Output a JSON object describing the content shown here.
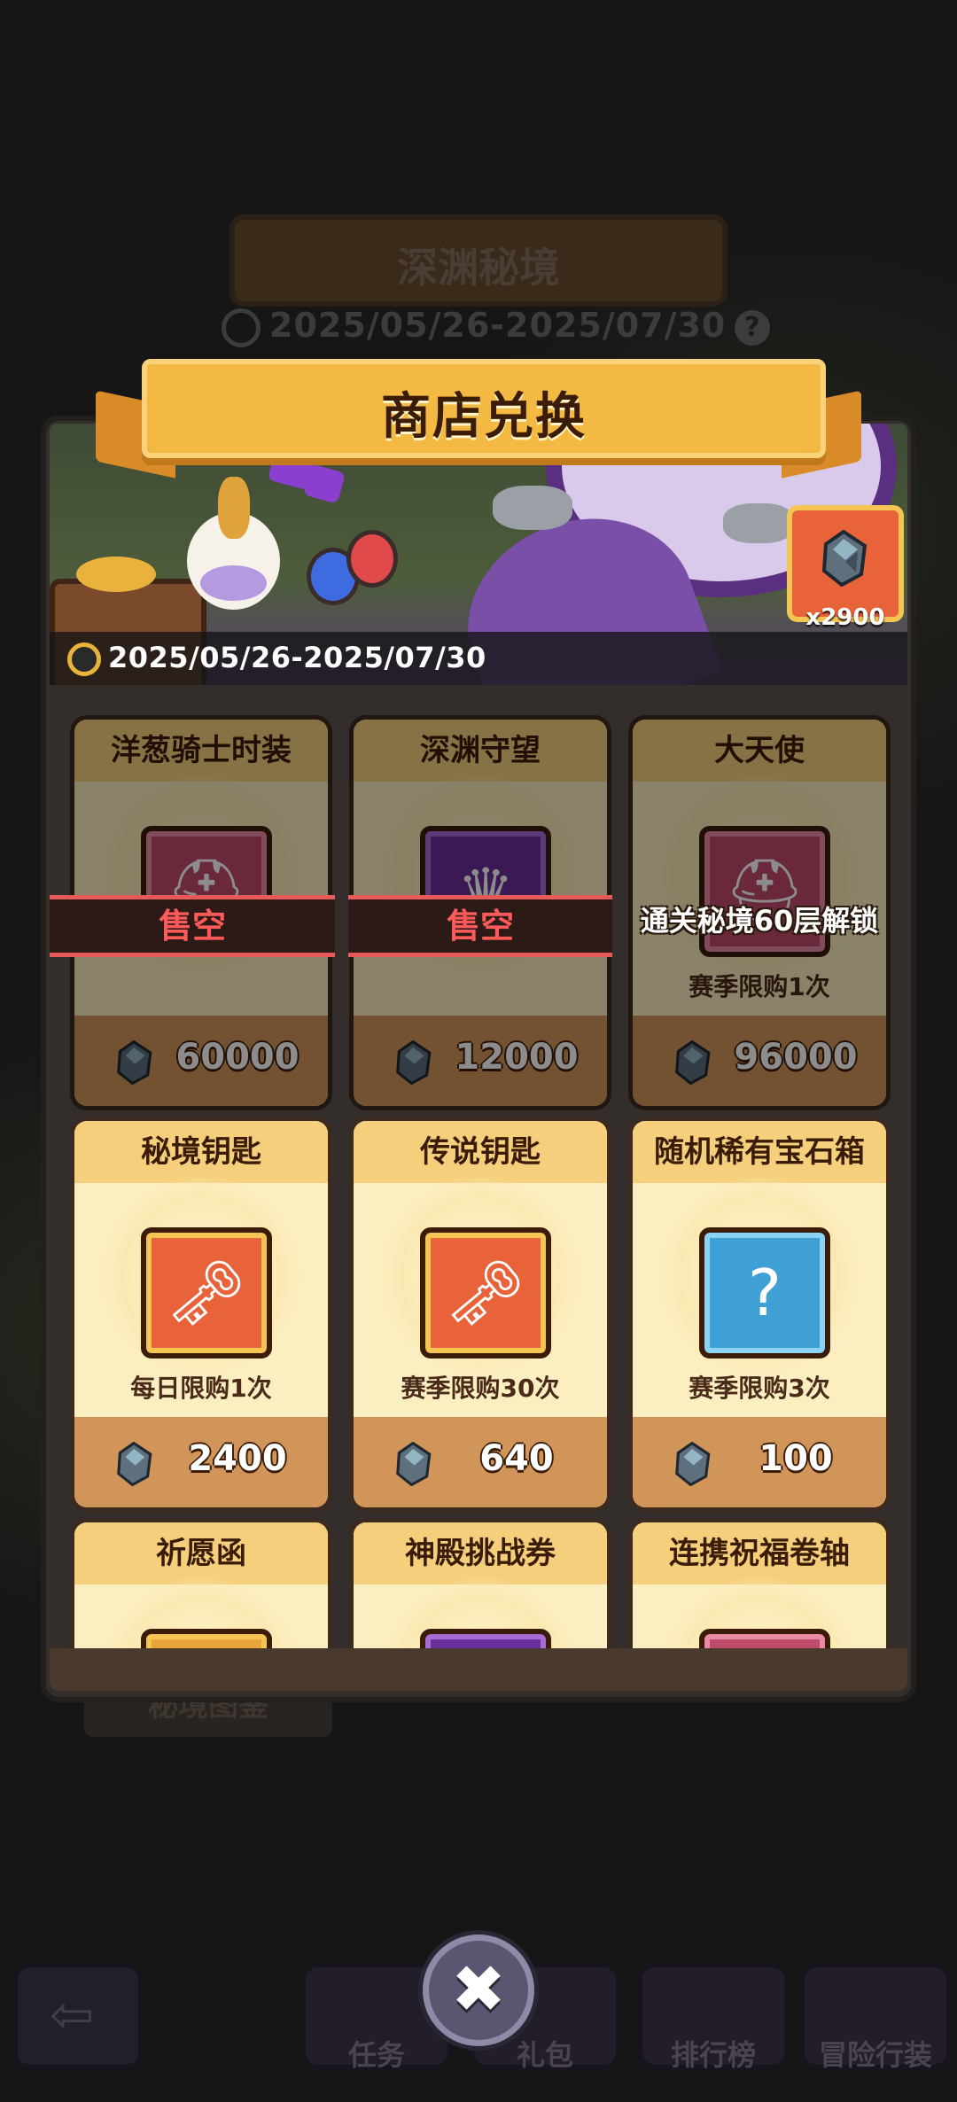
{
  "background": {
    "event_title": "深渊秘境",
    "event_dates": "2025/05/26-2025/07/30",
    "help_icon": "question-icon",
    "bestiary_label": "秘境图鉴"
  },
  "shop": {
    "title": "商店兑换",
    "dates": "2025/05/26-2025/07/30",
    "currency": {
      "icon": "abyss-stone-icon",
      "amount": "x2900"
    }
  },
  "items": [
    {
      "name": "洋葱骑士时装",
      "icon": "knight-helmet-icon",
      "status": "售空",
      "limit": "",
      "price": "60000"
    },
    {
      "name": "深渊守望",
      "icon": "abyss-frame-icon",
      "status": "售空",
      "limit": "",
      "price": "12000"
    },
    {
      "name": "大天使",
      "icon": "archangel-helmet-icon",
      "status": "通关秘境60层解锁",
      "limit": "赛季限购1次",
      "price": "96000"
    },
    {
      "name": "秘境钥匙",
      "icon": "realm-key-icon",
      "status": "",
      "limit": "每日限购1次",
      "price": "2400"
    },
    {
      "name": "传说钥匙",
      "icon": "legend-key-icon",
      "status": "",
      "limit": "赛季限购30次",
      "price": "640"
    },
    {
      "name": "随机稀有宝石箱",
      "icon": "gem-chest-icon",
      "status": "",
      "limit": "赛季限购3次",
      "price": "100"
    },
    {
      "name": "祈愿函",
      "icon": "wish-letter-icon",
      "status": "",
      "limit": "",
      "price": ""
    },
    {
      "name": "神殿挑战券",
      "icon": "temple-ticket-icon",
      "status": "",
      "limit": "",
      "price": ""
    },
    {
      "name": "连携祝福卷轴",
      "icon": "blessing-scroll-icon",
      "status": "",
      "limit": "",
      "price": ""
    }
  ],
  "nav": {
    "tasks": "任务",
    "gifts": "礼包",
    "ranking": "排行榜",
    "adventure": "冒险行装"
  },
  "colors": {
    "accent": "#f4b942",
    "soldout": "#ff5a5a",
    "price_bar": "#d1955a"
  }
}
